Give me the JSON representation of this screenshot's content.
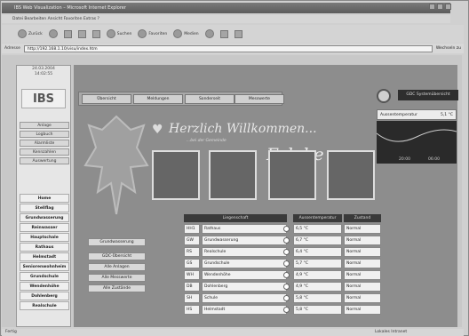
{
  "window": {
    "title": "IBS Web Visualization – Microsoft Internet Explorer"
  },
  "menubar": {
    "items": "Datei  Bearbeiten  Ansicht  Favoriten  Extras  ?"
  },
  "toolbar": {
    "back": "Zurück",
    "search": "Suchen",
    "favorites": "Favoriten",
    "media": "Medien"
  },
  "address": {
    "label": "Adresse",
    "url": "http://192.168.1.10/visu/index.htm",
    "go": "Wechseln zu"
  },
  "sidebar": {
    "date": "24.03.2004",
    "time": "14:02:55",
    "logo": "IBS",
    "buttons": [
      "Anlage",
      "Logbuch",
      "Alarmliste",
      "Kennzahlen",
      "Auswertung"
    ],
    "nav": [
      "Home",
      "Stellflag",
      "Grundwasserung",
      "Reinwasser",
      "Hauptschale",
      "Rathaus",
      "Helmstadt",
      "Seniorenwohnheim",
      "Grundschule",
      "Wendenhöhe",
      "Dohlenberg",
      "Realschule"
    ]
  },
  "tabs": [
    "Übersicht",
    "Meldungen",
    "Sonderseit",
    "Messwerte"
  ],
  "header_button": "GDC Systemübersicht",
  "welcome": {
    "line1": "Herzlich Willkommen...",
    "sub": "...bei der Gemeinde",
    "place": "Eslohe"
  },
  "temp_widget": {
    "label": "Aussentemperatur",
    "value": "5,1 °C"
  },
  "graph": {
    "left": "20:00",
    "right": "06:00"
  },
  "left_buttons": [
    "Grundwasserung",
    "GDC-Übersicht",
    "Alle Anlagen",
    "Alle Messwerte",
    "Alle Zustände"
  ],
  "table": {
    "headers": [
      "Liegenschaft",
      "Aussentemperatur",
      "Zustand"
    ],
    "rows": [
      {
        "id": "HH1",
        "name": "Rathaus",
        "temp": "6,5 °C",
        "state": "Normal"
      },
      {
        "id": "GW",
        "name": "Grundwasserung",
        "temp": "6,7 °C",
        "state": "Normal"
      },
      {
        "id": "RS",
        "name": "Realschule",
        "temp": "6,4 °C",
        "state": "Normal"
      },
      {
        "id": "GS",
        "name": "Grundschule",
        "temp": "5,7 °C",
        "state": "Normal"
      },
      {
        "id": "WH",
        "name": "Wendenhöhe",
        "temp": "4,9 °C",
        "state": "Normal"
      },
      {
        "id": "DB",
        "name": "Dohlenberg",
        "temp": "4,9 °C",
        "state": "Normal"
      },
      {
        "id": "SH",
        "name": "Schule",
        "temp": "5,8 °C",
        "state": "Normal"
      },
      {
        "id": "HS",
        "name": "Helmstadt",
        "temp": "5,8 °C",
        "state": "Normal"
      }
    ]
  },
  "status": {
    "left": "Fertig",
    "right": "Lokales Intranet"
  }
}
